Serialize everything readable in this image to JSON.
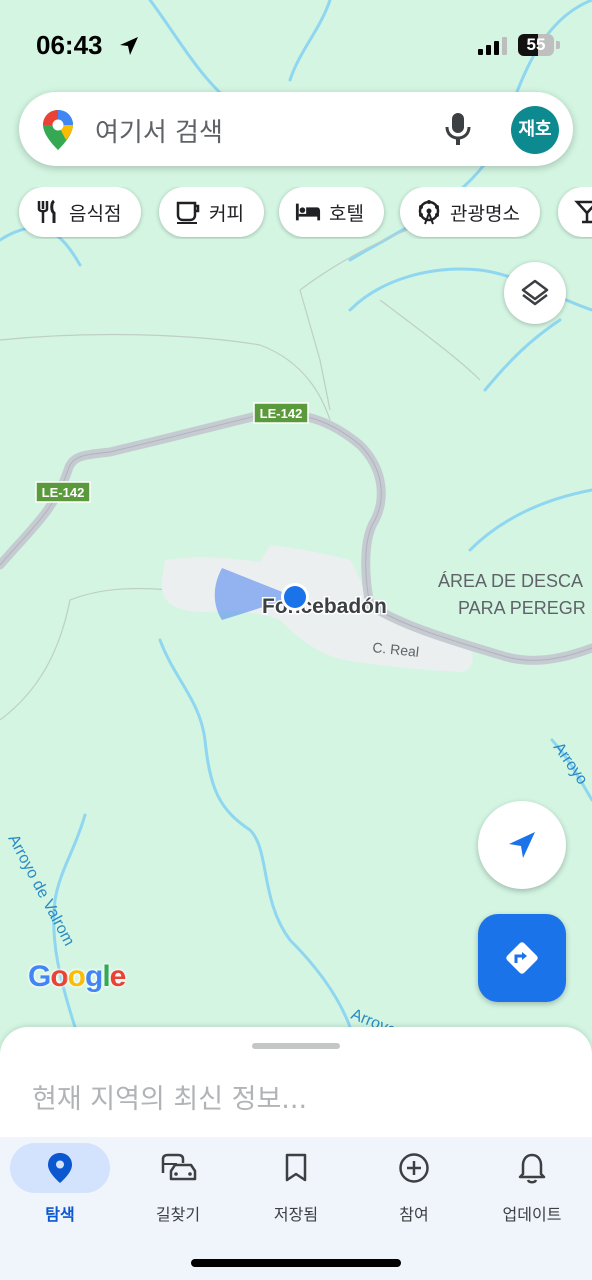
{
  "status_bar": {
    "time": "06:43",
    "battery": "55"
  },
  "search": {
    "placeholder": "여기서 검색",
    "avatar_text": "재호"
  },
  "chips": [
    {
      "label": "음식점",
      "icon": "fork-knife-icon"
    },
    {
      "label": "커피",
      "icon": "coffee-cup-icon"
    },
    {
      "label": "호텔",
      "icon": "bed-icon"
    },
    {
      "label": "관광명소",
      "icon": "ferris-wheel-icon"
    },
    {
      "label": "",
      "icon": "cocktail-icon"
    }
  ],
  "map": {
    "road_shields": [
      "LE-142",
      "LE-142"
    ],
    "place_name": "Foncebadón",
    "street_label": "C. Real",
    "area_label_line1": "ÁREA DE DESCA",
    "area_label_line2": "PARA PEREGR",
    "stream_label_1": "Arroyo de Valrom",
    "stream_label_2": "Arroyo",
    "stream_label_3": "Arroyo",
    "attribution": "Google"
  },
  "sheet": {
    "news_text": "현재 지역의 최신 정보..."
  },
  "bottom_nav": [
    {
      "label": "탐색",
      "icon": "explore-pin-icon",
      "active": true
    },
    {
      "label": "길찾기",
      "icon": "commute-car-icon",
      "active": false
    },
    {
      "label": "저장됨",
      "icon": "bookmark-icon",
      "active": false
    },
    {
      "label": "참여",
      "icon": "add-circle-icon",
      "active": false
    },
    {
      "label": "업데이트",
      "icon": "bell-icon",
      "active": false
    }
  ],
  "colors": {
    "map_bg": "#d3f5e2",
    "water": "#8fd6f0",
    "road": "#c6cbd2",
    "shield": "#5b9a3c",
    "accent": "#1a73e8",
    "active_tab": "#d3e3fd"
  }
}
